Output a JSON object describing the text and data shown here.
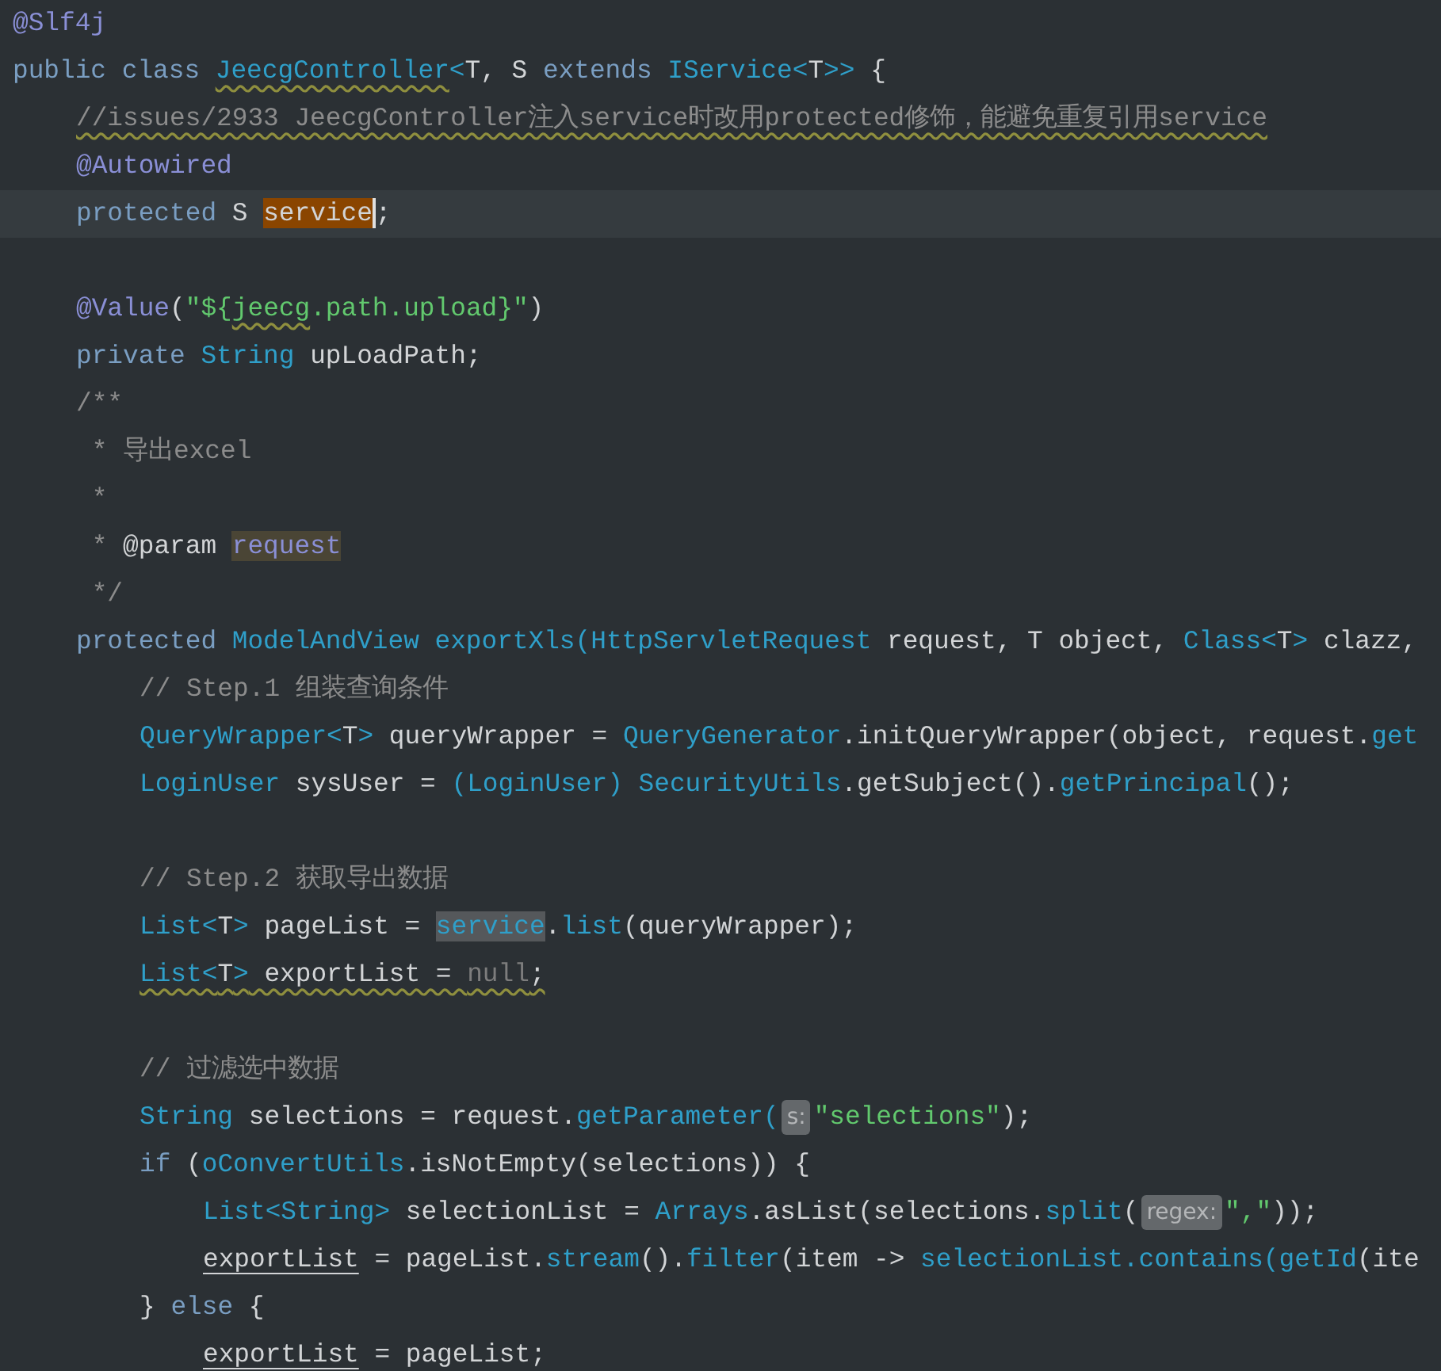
{
  "editor": {
    "lines": [
      {
        "tokens": [
          {
            "text": "@Slf4j",
            "kind": "annotation"
          }
        ]
      },
      {
        "tokens": [
          {
            "text": "public class ",
            "kind": "keyword"
          },
          {
            "text": "JeecgController",
            "kind": "type",
            "wavy": true
          },
          {
            "text": "<",
            "kind": "type"
          },
          {
            "text": "T, S ",
            "kind": "plain"
          },
          {
            "text": "extends ",
            "kind": "keyword"
          },
          {
            "text": "IService",
            "kind": "type"
          },
          {
            "text": "<",
            "kind": "type"
          },
          {
            "text": "T",
            "kind": "plain"
          },
          {
            "text": ">>",
            "kind": "type"
          },
          {
            "text": " {",
            "kind": "plain"
          }
        ],
        "children": [
          {
            "tokens": [
              {
                "text": "//issues/2933 JeecgController注入service时改用protected修饰，能避免重复引用service",
                "kind": "comment",
                "wavy": true
              }
            ]
          },
          {
            "tokens": [
              {
                "text": "@Autowired",
                "kind": "annotation"
              }
            ]
          },
          {
            "tokens": [
              {
                "text": "protected ",
                "kind": "keyword"
              },
              {
                "text": "S ",
                "kind": "plain"
              },
              {
                "text": "service",
                "kind": "plain",
                "occurrence_highlight": true,
                "caret": true
              },
              {
                "text": ";",
                "kind": "plain"
              }
            ]
          },
          {
            "blank_line_before": true,
            "tokens": [
              {
                "text": "@Value",
                "kind": "annotation"
              },
              {
                "text": "(",
                "kind": "plain"
              },
              {
                "text": "\"${",
                "kind": "string"
              },
              {
                "text": "jeecg",
                "kind": "string",
                "wavy": true
              },
              {
                "text": ".path.upload}\"",
                "kind": "string"
              },
              {
                "text": ")",
                "kind": "plain"
              }
            ]
          },
          {
            "tokens": [
              {
                "text": "private ",
                "kind": "keyword"
              },
              {
                "text": "String",
                "kind": "type"
              },
              {
                "text": " upLoadPath;",
                "kind": "plain"
              }
            ]
          },
          {
            "tokens": [
              {
                "text": "/**",
                "kind": "comment"
              }
            ]
          },
          {
            "tokens": [
              {
                "text": " * 导出excel",
                "kind": "comment"
              }
            ]
          },
          {
            "tokens": [
              {
                "text": " *",
                "kind": "comment"
              }
            ]
          },
          {
            "tokens": [
              {
                "text": " * ",
                "kind": "comment"
              },
              {
                "text": "@param ",
                "kind": "plain"
              },
              {
                "text": "request",
                "kind": "annotation",
                "doc_highlight": true
              }
            ]
          },
          {
            "tokens": [
              {
                "text": " */",
                "kind": "comment"
              }
            ]
          },
          {
            "tokens": [
              {
                "text": "protected ",
                "kind": "keyword"
              },
              {
                "text": "ModelAndView exportXls(HttpServletRequest",
                "kind": "type"
              },
              {
                "text": " request, T object, ",
                "kind": "plain"
              },
              {
                "text": "Class<",
                "kind": "type"
              },
              {
                "text": "T",
                "kind": "plain"
              },
              {
                "text": ">",
                "kind": "type"
              },
              {
                "text": " clazz,",
                "kind": "plain"
              }
            ],
            "children": [
              {
                "tokens": [
                  {
                    "text": "// Step.1 组装查询条件",
                    "kind": "comment"
                  }
                ]
              },
              {
                "tokens": [
                  {
                    "text": "QueryWrapper<",
                    "kind": "type"
                  },
                  {
                    "text": "T",
                    "kind": "plain"
                  },
                  {
                    "text": ">",
                    "kind": "type"
                  },
                  {
                    "text": " queryWrapper = ",
                    "kind": "plain"
                  },
                  {
                    "text": "QueryGenerator",
                    "kind": "type"
                  },
                  {
                    "text": ".initQueryWrapper(object, request.",
                    "kind": "plain"
                  },
                  {
                    "text": "get",
                    "kind": "type"
                  }
                ]
              },
              {
                "tokens": [
                  {
                    "text": "LoginUser",
                    "kind": "type"
                  },
                  {
                    "text": " sysUser = ",
                    "kind": "plain"
                  },
                  {
                    "text": "(LoginUser) ",
                    "kind": "type"
                  },
                  {
                    "text": "SecurityUtils",
                    "kind": "type"
                  },
                  {
                    "text": ".getSubject().",
                    "kind": "plain"
                  },
                  {
                    "text": "getPrincipal",
                    "kind": "type"
                  },
                  {
                    "text": "();",
                    "kind": "plain"
                  }
                ]
              },
              {
                "blank_line_before": true,
                "tokens": [
                  {
                    "text": "// Step.2 获取导出数据",
                    "kind": "comment"
                  }
                ]
              },
              {
                "tokens": [
                  {
                    "text": "List<",
                    "kind": "type"
                  },
                  {
                    "text": "T",
                    "kind": "plain"
                  },
                  {
                    "text": ">",
                    "kind": "type"
                  },
                  {
                    "text": " pageList = ",
                    "kind": "plain"
                  },
                  {
                    "text": "service",
                    "kind": "type",
                    "usage_highlight": true
                  },
                  {
                    "text": ".",
                    "kind": "plain"
                  },
                  {
                    "text": "list",
                    "kind": "type"
                  },
                  {
                    "text": "(queryWrapper);",
                    "kind": "plain"
                  }
                ]
              },
              {
                "tokens": [
                  {
                    "text": "List<",
                    "kind": "type",
                    "wavy": true
                  },
                  {
                    "text": "T",
                    "kind": "plain",
                    "wavy": true
                  },
                  {
                    "text": ">",
                    "kind": "type",
                    "wavy": true
                  },
                  {
                    "text": " exportList = ",
                    "kind": "plain",
                    "wavy": true
                  },
                  {
                    "text": "null",
                    "kind": "dim",
                    "wavy": true
                  },
                  {
                    "text": ";",
                    "kind": "plain",
                    "wavy": true
                  }
                ]
              },
              {
                "blank_line_before": true,
                "tokens": [
                  {
                    "text": "// 过滤选中数据",
                    "kind": "comment"
                  }
                ]
              },
              {
                "tokens": [
                  {
                    "text": "String",
                    "kind": "type"
                  },
                  {
                    "text": " selections = request.",
                    "kind": "plain"
                  },
                  {
                    "text": "getParameter(",
                    "kind": "type"
                  },
                  {
                    "text": "s:",
                    "kind": "hint"
                  },
                  {
                    "text": "\"selections\"",
                    "kind": "string"
                  },
                  {
                    "text": ");",
                    "kind": "plain"
                  }
                ]
              },
              {
                "tokens": [
                  {
                    "text": "if ",
                    "kind": "keyword"
                  },
                  {
                    "text": "(",
                    "kind": "plain"
                  },
                  {
                    "text": "oConvertUtils",
                    "kind": "type"
                  },
                  {
                    "text": ".isNotEmpty(selections)) {",
                    "kind": "plain"
                  }
                ],
                "children": [
                  {
                    "tokens": [
                      {
                        "text": "List<String>",
                        "kind": "type"
                      },
                      {
                        "text": " selectionList = ",
                        "kind": "plain"
                      },
                      {
                        "text": "Arrays",
                        "kind": "type"
                      },
                      {
                        "text": ".asList(selections.",
                        "kind": "plain"
                      },
                      {
                        "text": "split",
                        "kind": "type"
                      },
                      {
                        "text": "(",
                        "kind": "plain"
                      },
                      {
                        "text": "regex:",
                        "kind": "hint"
                      },
                      {
                        "text": "\",\"",
                        "kind": "string"
                      },
                      {
                        "text": "));",
                        "kind": "plain"
                      }
                    ]
                  },
                  {
                    "tokens": [
                      {
                        "text": "exportList",
                        "kind": "plain",
                        "underlined": true
                      },
                      {
                        "text": " = pageList.",
                        "kind": "plain"
                      },
                      {
                        "text": "stream",
                        "kind": "type"
                      },
                      {
                        "text": "().",
                        "kind": "plain"
                      },
                      {
                        "text": "filter",
                        "kind": "type"
                      },
                      {
                        "text": "(item -> ",
                        "kind": "plain"
                      },
                      {
                        "text": "selectionList.contains(getId",
                        "kind": "type"
                      },
                      {
                        "text": "(ite",
                        "kind": "plain"
                      }
                    ]
                  }
                ]
              },
              {
                "tokens": [
                  {
                    "text": "} ",
                    "kind": "plain"
                  },
                  {
                    "text": "else",
                    "kind": "keyword"
                  },
                  {
                    "text": " {",
                    "kind": "plain"
                  }
                ],
                "children": [
                  {
                    "tokens": [
                      {
                        "text": "exportList",
                        "kind": "plain",
                        "underlined": true
                      },
                      {
                        "text": " = pageList;",
                        "kind": "plain"
                      }
                    ]
                  }
                ]
              }
            ]
          }
        ]
      }
    ]
  }
}
